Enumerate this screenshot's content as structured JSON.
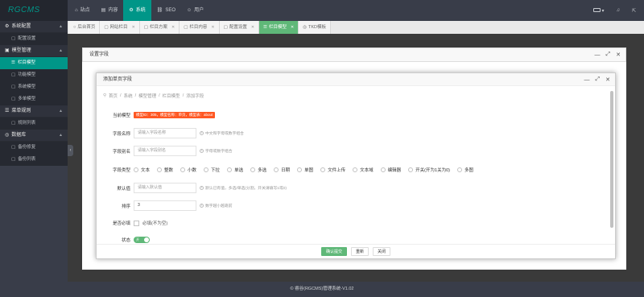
{
  "app": {
    "logo": "RGCMS"
  },
  "topnav": [
    {
      "label": "站点",
      "icon": "home-icon"
    },
    {
      "label": "内容",
      "icon": "file-icon"
    },
    {
      "label": "系统",
      "icon": "gear-icon"
    },
    {
      "label": "SEO",
      "icon": "link-icon"
    },
    {
      "label": "用户",
      "icon": "user-icon"
    }
  ],
  "sidebar": {
    "groups": [
      {
        "label": "系统配置",
        "items": [
          {
            "label": "配置设置"
          }
        ]
      },
      {
        "label": "模型管理",
        "items": [
          {
            "label": "栏目模型"
          },
          {
            "label": "功能模型"
          },
          {
            "label": "系统模型"
          },
          {
            "label": "多单模型"
          }
        ]
      },
      {
        "label": "菜单规则",
        "items": [
          {
            "label": "规则列表"
          }
        ]
      },
      {
        "label": "数据库",
        "items": [
          {
            "label": "备份修复"
          },
          {
            "label": "备份列表"
          }
        ]
      }
    ]
  },
  "tabs": [
    {
      "label": "后台首页"
    },
    {
      "label": "网站栏目"
    },
    {
      "label": "栏目方案"
    },
    {
      "label": "栏目内容"
    },
    {
      "label": "配置设置"
    },
    {
      "label": "栏目模型"
    },
    {
      "label": "TKD模板"
    }
  ],
  "outer_dialog": {
    "title": "设置字段"
  },
  "inner_dialog": {
    "title": "添加单页字段",
    "breadcrumb": [
      "首页",
      "系统",
      "模型管理",
      "栏目模型",
      "添加字段"
    ],
    "current_model_label": "当前模型",
    "current_model_value": "模型ID：305，模型名称：单页，模型表：about",
    "field_name": {
      "label": "字段名称",
      "placeholder": "请输入字段名称",
      "hint": "中文和字母或数字组合"
    },
    "field_alias": {
      "label": "字段别名",
      "placeholder": "请输入字段别名",
      "hint": "字母或数字组合"
    },
    "field_type": {
      "label": "字段类型",
      "options": [
        "文本",
        "整数",
        "小数",
        "下拉",
        "单选",
        "多选",
        "日期",
        "单图",
        "文件上传",
        "文本域",
        "编辑器",
        "开关(开为1关为0)",
        "多图"
      ]
    },
    "default_value": {
      "label": "默认值",
      "placeholder": "请输入默认值",
      "hint": "默认已有值，多选/单选(分割，开关请填写1或0)"
    },
    "sort": {
      "label": "排序",
      "value": "3",
      "hint": "数字越小越靠前"
    },
    "required": {
      "label": "是否必填",
      "checkbox_label": "必填(不为空)"
    },
    "status": {
      "label": "状态",
      "toggle_text": "开"
    },
    "buttons": {
      "submit": "确认提交",
      "reset": "重新",
      "close": "关闭"
    }
  },
  "footer": {
    "text": "© 睿谷(RGCMS)管理系统-V1.02"
  }
}
